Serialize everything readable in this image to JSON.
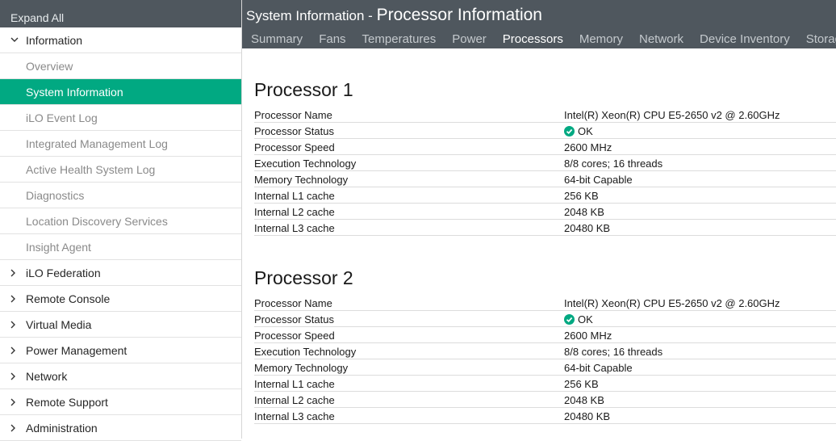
{
  "sidebar": {
    "expand_all": "Expand All",
    "information": "Information",
    "sub_items": [
      "Overview",
      "System Information",
      "iLO Event Log",
      "Integrated Management Log",
      "Active Health System Log",
      "Diagnostics",
      "Location Discovery Services",
      "Insight Agent"
    ],
    "sections": [
      "iLO Federation",
      "Remote Console",
      "Virtual Media",
      "Power Management",
      "Network",
      "Remote Support",
      "Administration"
    ]
  },
  "header": {
    "title_part1": "System Information",
    "title_sep": " - ",
    "title_part2": "Processor Information",
    "tabs": [
      "Summary",
      "Fans",
      "Temperatures",
      "Power",
      "Processors",
      "Memory",
      "Network",
      "Device Inventory",
      "Storage"
    ]
  },
  "processors": [
    {
      "title": "Processor 1",
      "rows": [
        {
          "label": "Processor Name",
          "value": "Intel(R) Xeon(R) CPU E5-2650 v2 @ 2.60GHz"
        },
        {
          "label": "Processor Status",
          "value": "OK"
        },
        {
          "label": "Processor Speed",
          "value": "2600 MHz"
        },
        {
          "label": "Execution Technology",
          "value": "8/8 cores; 16 threads"
        },
        {
          "label": "Memory Technology",
          "value": "64-bit Capable"
        },
        {
          "label": "Internal L1 cache",
          "value": "256 KB"
        },
        {
          "label": "Internal L2 cache",
          "value": "2048 KB"
        },
        {
          "label": "Internal L3 cache",
          "value": "20480 KB"
        }
      ]
    },
    {
      "title": "Processor 2",
      "rows": [
        {
          "label": "Processor Name",
          "value": "Intel(R) Xeon(R) CPU E5-2650 v2 @ 2.60GHz"
        },
        {
          "label": "Processor Status",
          "value": "OK"
        },
        {
          "label": "Processor Speed",
          "value": "2600 MHz"
        },
        {
          "label": "Execution Technology",
          "value": "8/8 cores; 16 threads"
        },
        {
          "label": "Memory Technology",
          "value": "64-bit Capable"
        },
        {
          "label": "Internal L1 cache",
          "value": "256 KB"
        },
        {
          "label": "Internal L2 cache",
          "value": "2048 KB"
        },
        {
          "label": "Internal L3 cache",
          "value": "20480 KB"
        }
      ]
    }
  ],
  "colors": {
    "header_bg": "#4f575e",
    "active_green": "#01a982",
    "ok_green": "#01a982"
  }
}
